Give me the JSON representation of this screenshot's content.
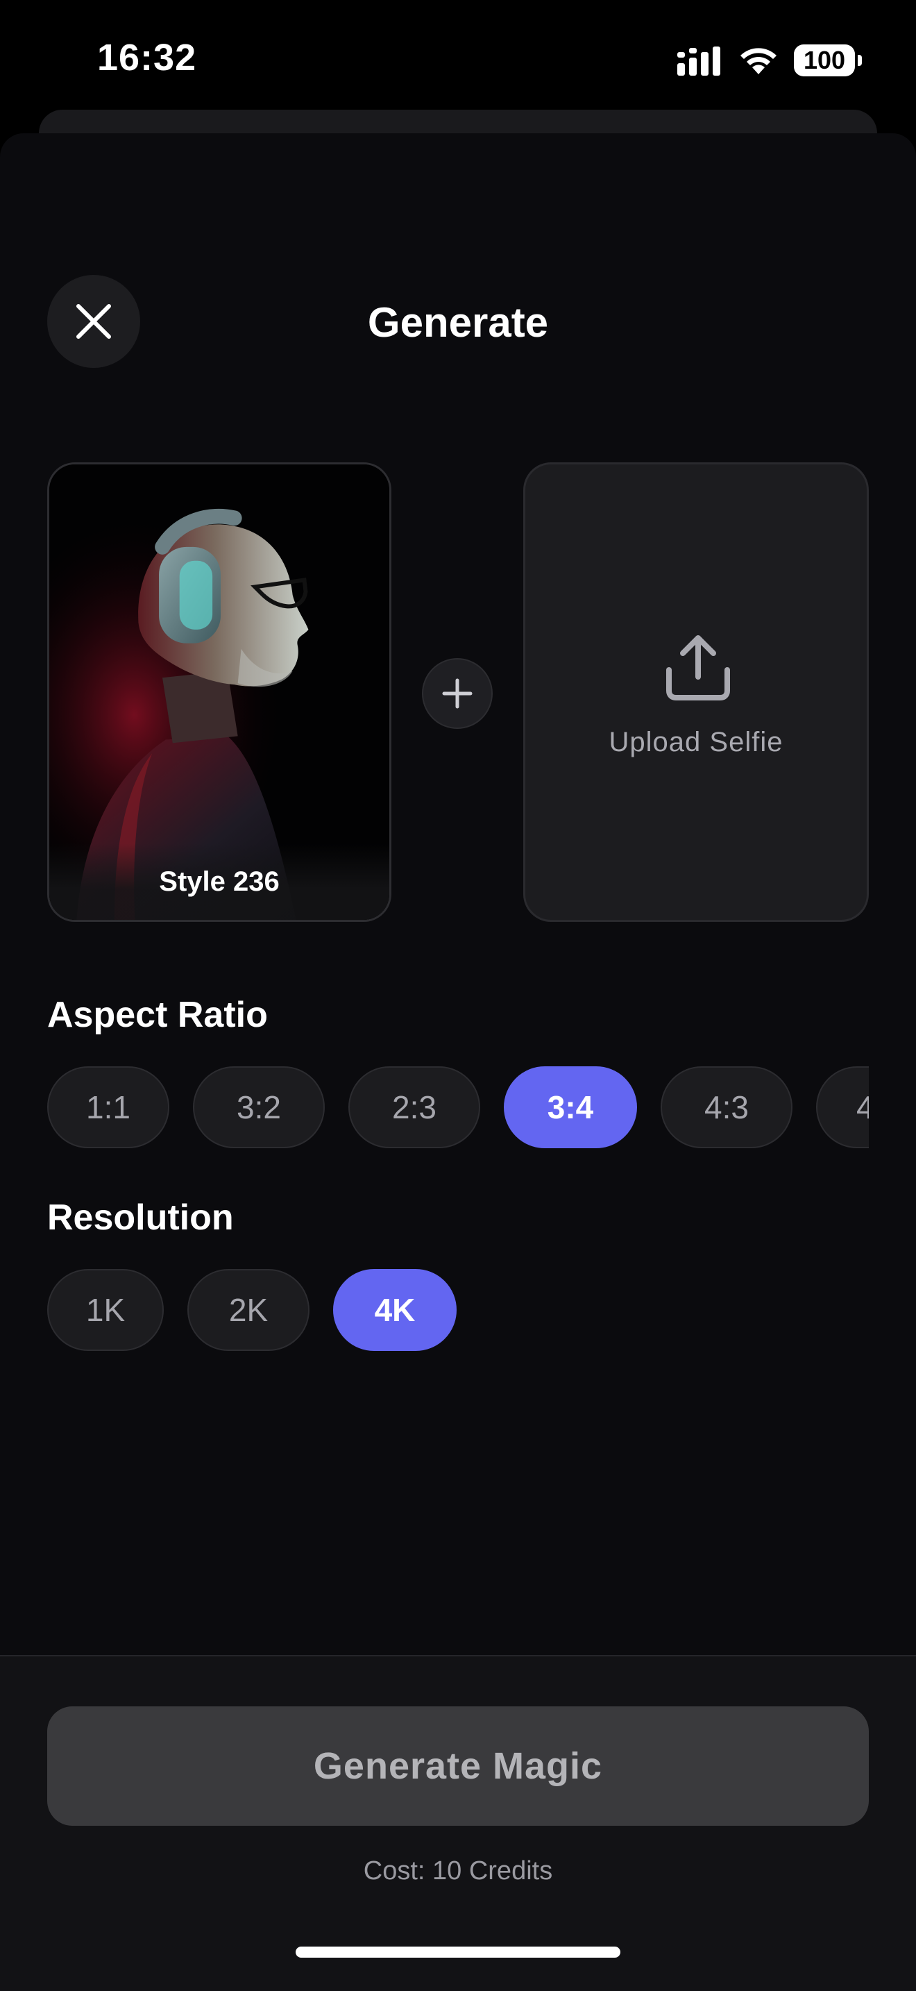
{
  "status_bar": {
    "time": "16:32",
    "battery": "100",
    "signal_icon": "cellular-signal-icon",
    "wifi_icon": "wifi-icon"
  },
  "header": {
    "title": "Generate",
    "close_icon": "close-icon"
  },
  "style_card": {
    "label": "Style 236"
  },
  "plus_icon": "plus-icon",
  "upload": {
    "label": "Upload Selfie",
    "icon": "upload-icon"
  },
  "aspect_ratio": {
    "title": "Aspect Ratio",
    "options": [
      "1:1",
      "3:2",
      "2:3",
      "3:4",
      "4:3",
      "4"
    ],
    "selected": "3:4"
  },
  "resolution": {
    "title": "Resolution",
    "options": [
      "1K",
      "2K",
      "4K"
    ],
    "selected": "4K"
  },
  "generate": {
    "button_label": "Generate Magic",
    "cost": "Cost: 10 Credits"
  },
  "colors": {
    "accent": "#6366f1",
    "sheet_bg": "#0b0b0e",
    "pill_bg": "#1c1c1f"
  }
}
